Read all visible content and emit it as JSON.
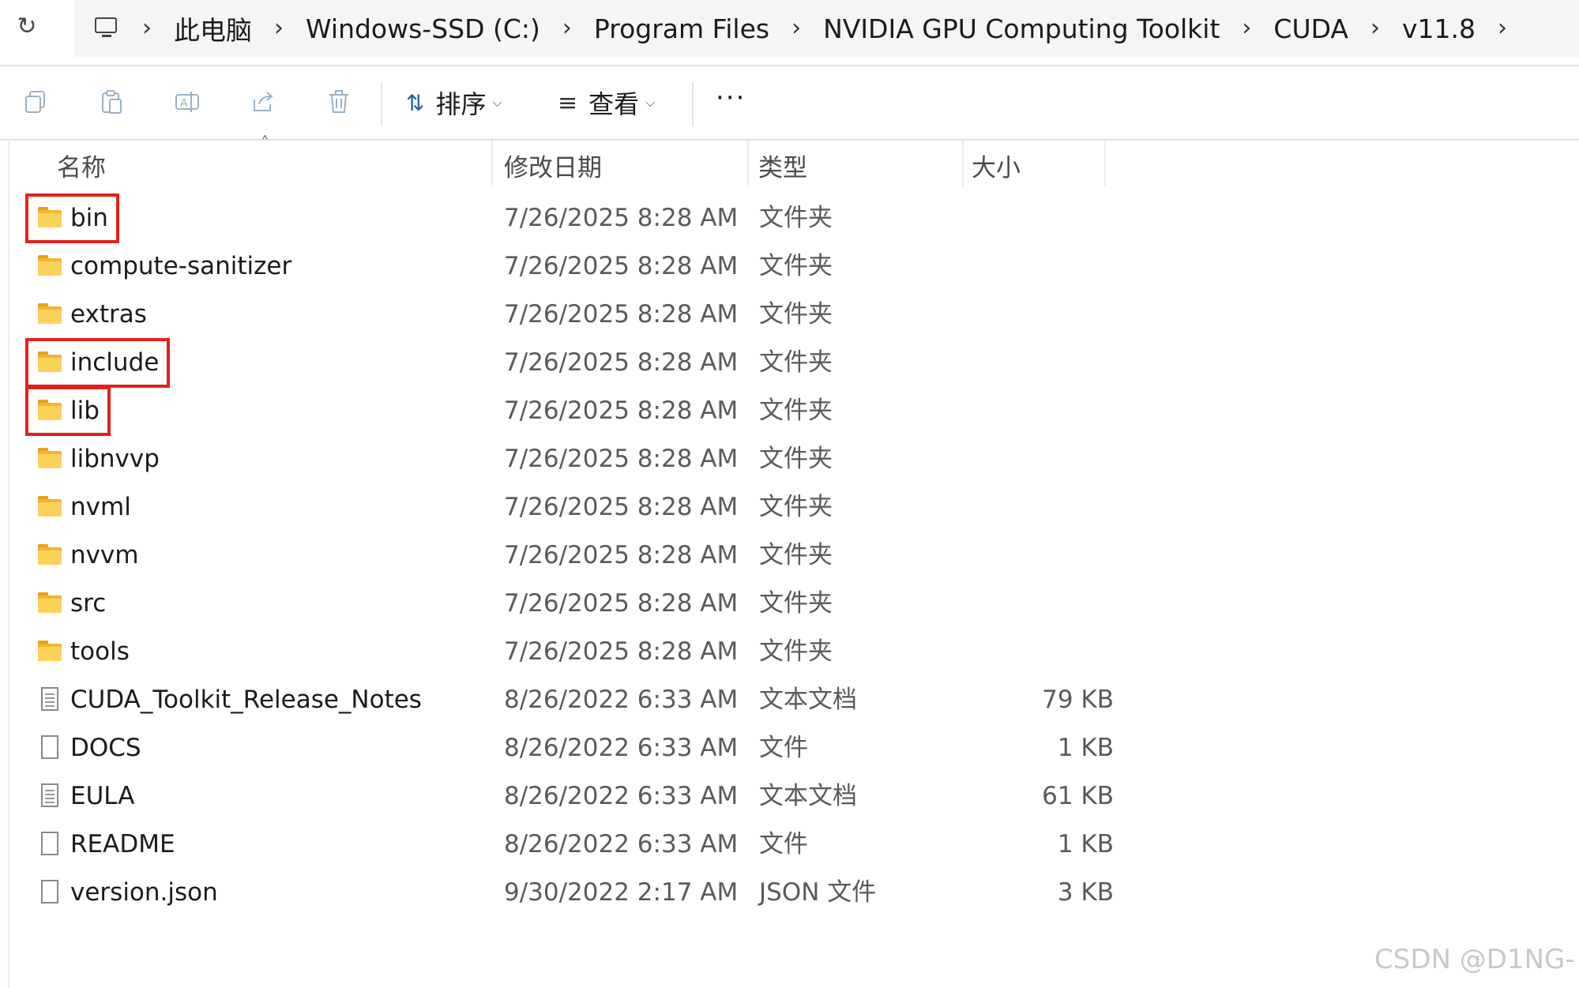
{
  "breadcrumb": [
    "此电脑",
    "Windows-SSD (C:)",
    "Program Files",
    "NVIDIA GPU Computing Toolkit",
    "CUDA",
    "v11.8"
  ],
  "toolbar": {
    "sort_label": "排序",
    "view_label": "查看",
    "more_label": "···"
  },
  "columns": {
    "name": "名称",
    "date": "修改日期",
    "type": "类型",
    "size": "大小"
  },
  "files": [
    {
      "name": "bin",
      "date": "7/26/2025 8:28 AM",
      "type": "文件夹",
      "size": "",
      "kind": "folder",
      "highlight": true
    },
    {
      "name": "compute-sanitizer",
      "date": "7/26/2025 8:28 AM",
      "type": "文件夹",
      "size": "",
      "kind": "folder",
      "highlight": false
    },
    {
      "name": "extras",
      "date": "7/26/2025 8:28 AM",
      "type": "文件夹",
      "size": "",
      "kind": "folder",
      "highlight": false
    },
    {
      "name": "include",
      "date": "7/26/2025 8:28 AM",
      "type": "文件夹",
      "size": "",
      "kind": "folder",
      "highlight": true
    },
    {
      "name": "lib",
      "date": "7/26/2025 8:28 AM",
      "type": "文件夹",
      "size": "",
      "kind": "folder",
      "highlight": true
    },
    {
      "name": "libnvvp",
      "date": "7/26/2025 8:28 AM",
      "type": "文件夹",
      "size": "",
      "kind": "folder",
      "highlight": false
    },
    {
      "name": "nvml",
      "date": "7/26/2025 8:28 AM",
      "type": "文件夹",
      "size": "",
      "kind": "folder",
      "highlight": false
    },
    {
      "name": "nvvm",
      "date": "7/26/2025 8:28 AM",
      "type": "文件夹",
      "size": "",
      "kind": "folder",
      "highlight": false
    },
    {
      "name": "src",
      "date": "7/26/2025 8:28 AM",
      "type": "文件夹",
      "size": "",
      "kind": "folder",
      "highlight": false
    },
    {
      "name": "tools",
      "date": "7/26/2025 8:28 AM",
      "type": "文件夹",
      "size": "",
      "kind": "folder",
      "highlight": false
    },
    {
      "name": "CUDA_Toolkit_Release_Notes",
      "date": "8/26/2022 6:33 AM",
      "type": "文本文档",
      "size": "79 KB",
      "kind": "text",
      "highlight": false
    },
    {
      "name": "DOCS",
      "date": "8/26/2022 6:33 AM",
      "type": "文件",
      "size": "1 KB",
      "kind": "file",
      "highlight": false
    },
    {
      "name": "EULA",
      "date": "8/26/2022 6:33 AM",
      "type": "文本文档",
      "size": "61 KB",
      "kind": "text",
      "highlight": false
    },
    {
      "name": "README",
      "date": "8/26/2022 6:33 AM",
      "type": "文件",
      "size": "1 KB",
      "kind": "file",
      "highlight": false
    },
    {
      "name": "version.json",
      "date": "9/30/2022 2:17 AM",
      "type": "JSON 文件",
      "size": "3 KB",
      "kind": "file",
      "highlight": false
    }
  ],
  "icons": {
    "refresh": "refresh-icon",
    "pc": "computer-icon",
    "copy": "copy-icon",
    "paste": "paste-icon",
    "rename": "rename-icon",
    "share": "share-icon",
    "delete": "delete-icon",
    "sort": "sort-icon",
    "view": "view-icon",
    "folder": "folder-icon",
    "file": "file-icon"
  },
  "colors": {
    "highlight": "#e3211d",
    "folder": "#f2b531",
    "address_bg": "#f3f6f3"
  },
  "watermark": "CSDN @D1NG-"
}
